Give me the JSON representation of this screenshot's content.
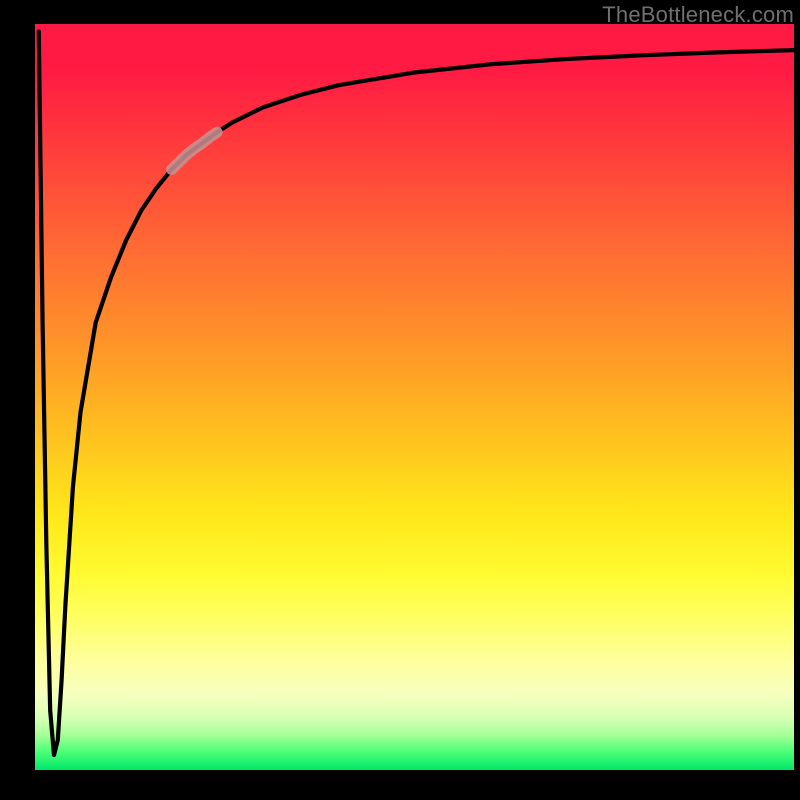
{
  "watermark": "TheBottleneck.com",
  "chart_data": {
    "type": "line",
    "title": "",
    "xlabel": "",
    "ylabel": "",
    "xlim": [
      0,
      100
    ],
    "ylim": [
      0,
      100
    ],
    "grid": false,
    "legend": false,
    "series": [
      {
        "name": "bottleneck-curve",
        "color": "#000000",
        "x": [
          0.5,
          1.0,
          1.5,
          2.0,
          2.5,
          3.0,
          3.5,
          4.0,
          5.0,
          6.0,
          8.0,
          10,
          12,
          14,
          16,
          18,
          20,
          22,
          24,
          26,
          30,
          35,
          40,
          50,
          60,
          70,
          80,
          90,
          100
        ],
        "y": [
          99,
          60,
          30,
          8,
          2,
          4,
          12,
          22,
          38,
          48,
          60,
          66,
          71,
          75,
          78,
          80.5,
          82.5,
          84,
          85.5,
          86.8,
          88.8,
          90.5,
          91.8,
          93.5,
          94.6,
          95.3,
          95.8,
          96.2,
          96.5
        ]
      },
      {
        "name": "highlight-segment",
        "color": "#c78a8a",
        "x": [
          18,
          19,
          20,
          21,
          22,
          23,
          24
        ],
        "y": [
          80.5,
          81.5,
          82.5,
          83.3,
          84.0,
          84.8,
          85.5
        ]
      }
    ],
    "annotations": []
  }
}
